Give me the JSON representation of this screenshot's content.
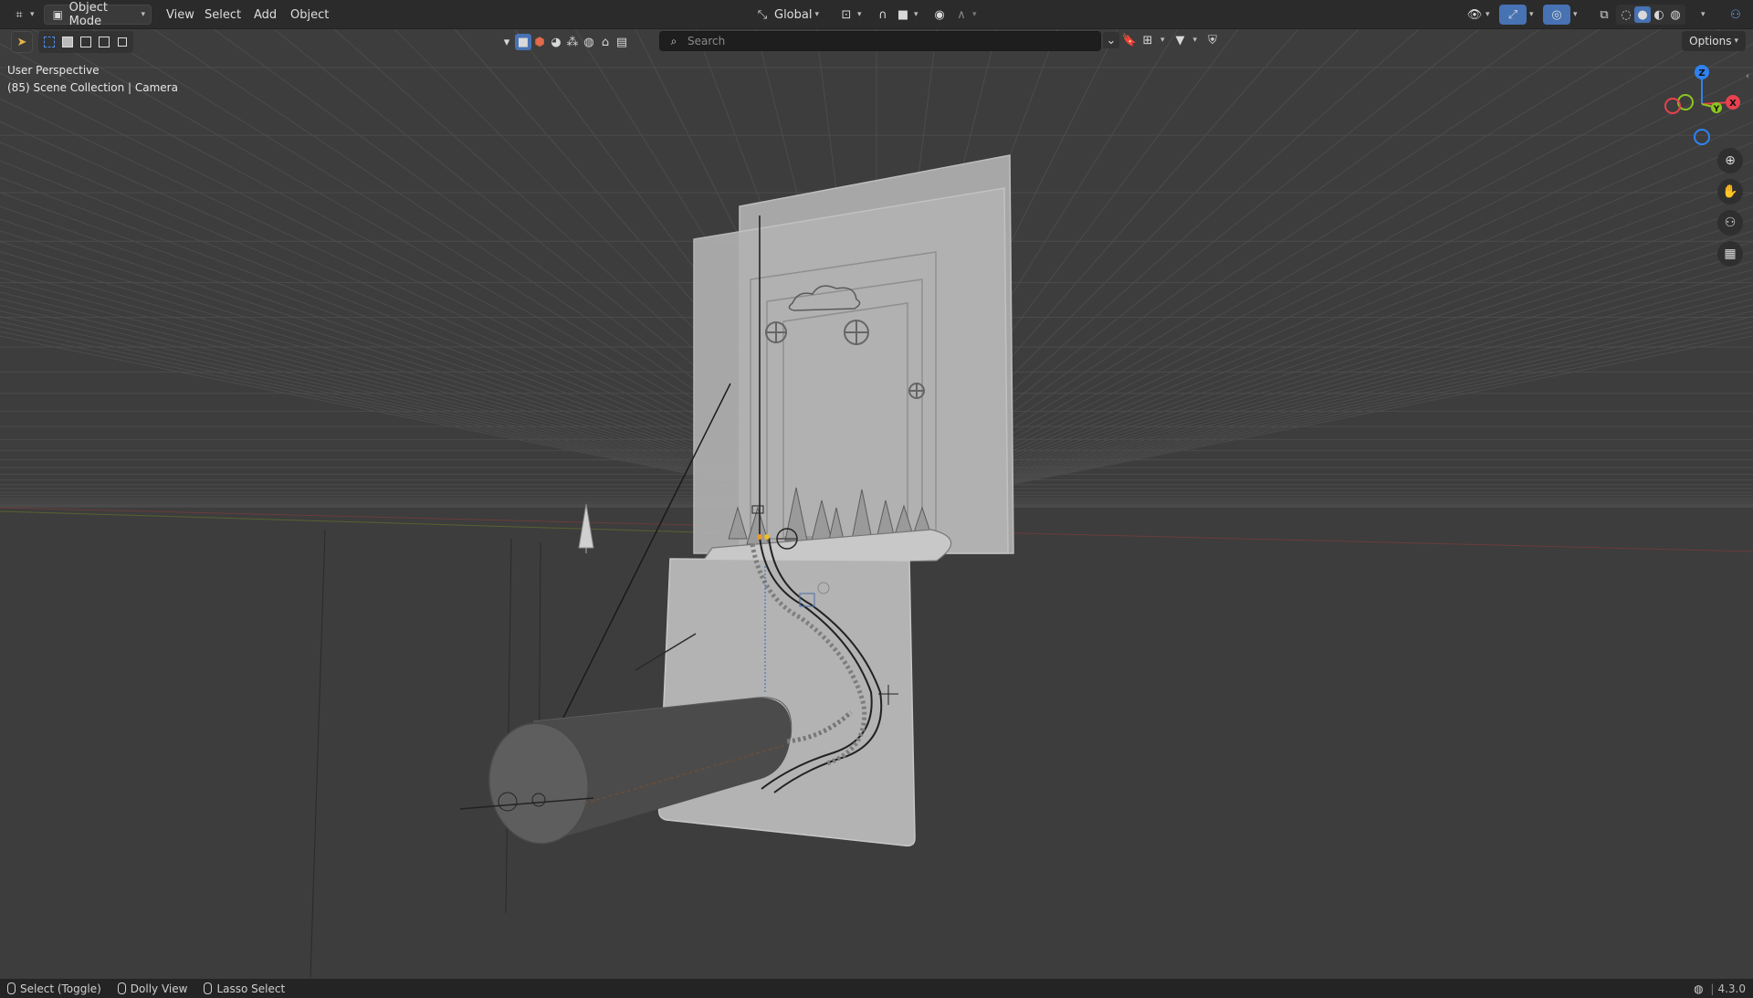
{
  "header": {
    "editor_type_icon": "grid-editor-icon",
    "mode_label": "Object Mode",
    "menu": [
      "View",
      "Select",
      "Add",
      "Object"
    ],
    "transform_orientation": "Global"
  },
  "toolbar": {
    "search_placeholder": "Search",
    "options_label": "Options"
  },
  "viewport": {
    "perspective_label": "User Perspective",
    "collection_label": "(85) Scene Collection | Camera",
    "gizmo": {
      "z": "Z",
      "y": "Y",
      "x": "X"
    }
  },
  "statusbar": {
    "items": [
      "Select (Toggle)",
      "Dolly View",
      "Lasso Select"
    ],
    "version": "4.3.0"
  },
  "colors": {
    "axis_x": "#e8424f",
    "axis_y": "#8cc41f",
    "axis_z": "#2f82f0",
    "accent": "#4772b3"
  }
}
